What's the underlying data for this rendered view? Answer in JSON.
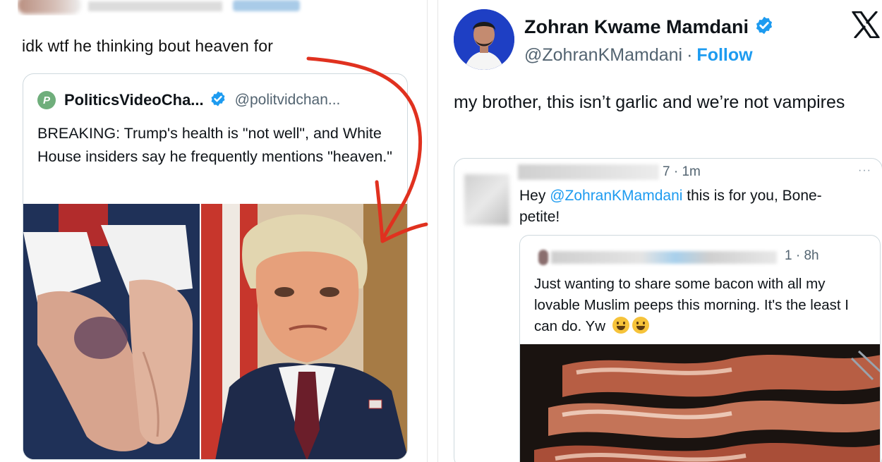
{
  "left": {
    "tweet_text": "idk wtf he thinking bout heaven for",
    "quote": {
      "avatar_letter": "P",
      "name": "PoliticsVideoCha...",
      "handle": "@politvidchan...",
      "text": "BREAKING: Trump's health is \"not well\", and White House insiders say he frequently mentions \"heaven.\""
    }
  },
  "right": {
    "author_name": "Zohran Kwame Mamdani",
    "author_handle": "@ZohranKMamdani",
    "separator": "·",
    "follow_label": "Follow",
    "tweet_text": "my brother, this isn’t garlic and we’re not vampires",
    "quoted": {
      "meta": "7 · 1m",
      "more": "···",
      "text_prefix": "Hey ",
      "mention": "@ZohranKMamdani",
      "text_suffix": " this is for you, Bone-petite!",
      "inner": {
        "meta": "1 · 8h",
        "text": "Just wanting to share some bacon with all my lovable Muslim peeps this morning. It's the least I can do. Yw"
      }
    }
  },
  "colors": {
    "link_blue": "#1d9bf0",
    "verified_blue": "#1d9bf0",
    "arrow_red": "#e0311f",
    "border": "#cfd9de"
  },
  "icons": {
    "verified": "verified-badge-icon",
    "x_logo": "x-logo-icon",
    "emoji": "grinning-face-emoji-icon"
  }
}
